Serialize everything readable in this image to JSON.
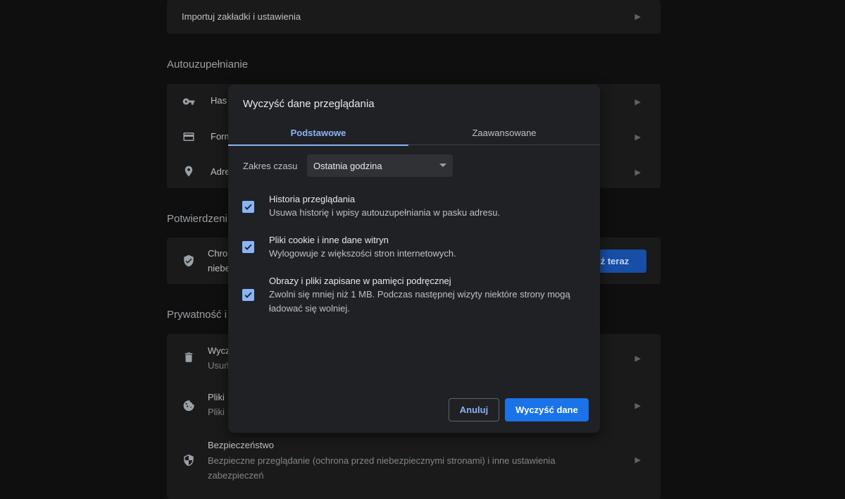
{
  "background": {
    "import_row": {
      "label": "Importuj zakładki i ustawienia"
    },
    "autofill": {
      "title": "Autouzupełnianie",
      "items": [
        {
          "label": "Has",
          "icon": "key-icon"
        },
        {
          "label": "Form",
          "icon": "credit-card-icon"
        },
        {
          "label": "Adre",
          "icon": "location-pin-icon"
        }
      ]
    },
    "safety": {
      "title": "Potwierdzeni",
      "line1": "Chro",
      "line2": "niebe",
      "button_label": "dź teraz"
    },
    "privacy": {
      "title": "Prywatność i",
      "items": [
        {
          "title": "Wycz",
          "sub": "Usuń",
          "icon": "trash-icon"
        },
        {
          "title": "Pliki",
          "sub": "Pliki",
          "icon": "cookie-icon"
        },
        {
          "title": "Bezpieczeństwo",
          "sub": "Bezpieczne przeglądanie (ochrona przed niebezpiecznymi stronami) i inne ustawienia zabezpieczeń",
          "icon": "shield-icon"
        }
      ]
    }
  },
  "dialog": {
    "title": "Wyczyść dane przeglądania",
    "tabs": [
      {
        "label": "Podstawowe",
        "active": true
      },
      {
        "label": "Zaawansowane",
        "active": false
      }
    ],
    "time_range": {
      "label": "Zakres czasu",
      "value": "Ostatnia godzina"
    },
    "options": [
      {
        "title": "Historia przeglądania",
        "desc": "Usuwa historię i wpisy autouzupełniania w pasku adresu.",
        "checked": true
      },
      {
        "title": "Pliki cookie i inne dane witryn",
        "desc": "Wylogowuje z większości stron internetowych.",
        "checked": true
      },
      {
        "title": "Obrazy i pliki zapisane w pamięci podręcznej",
        "desc": "Zwolni się mniej niż 1 MB. Podczas następnej wizyty niektóre strony mogą ładować się wolniej.",
        "checked": true
      }
    ],
    "cancel_label": "Anuluj",
    "clear_label": "Wyczyść dane"
  },
  "colors": {
    "accent": "#8ab4f8",
    "primary_button": "#1a73e8",
    "dialog_bg": "#202124"
  }
}
